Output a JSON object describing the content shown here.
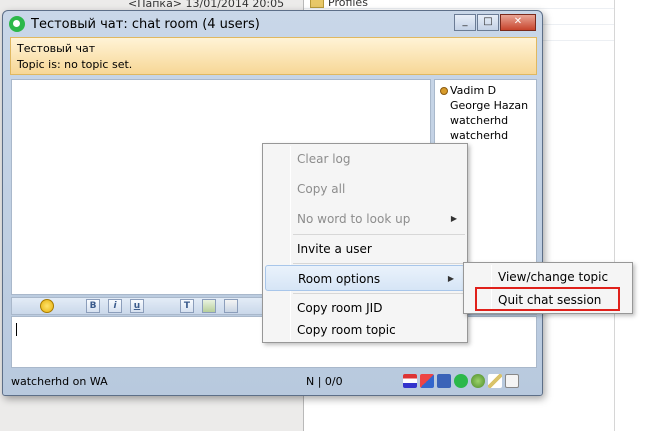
{
  "background": {
    "crumb_text": "<Папка>   13/01/2014 20:05",
    "profiles_label": "Profiles"
  },
  "window": {
    "title": "Тестовый чат: chat room (4 users)",
    "buttons": {
      "minimize": "_",
      "maximize": "□",
      "close": "✕"
    }
  },
  "topic": {
    "room_name": "Тестовый чат",
    "topic_line": "Topic is:  no topic set."
  },
  "users": [
    {
      "name": "Vadim D",
      "status_icon": "status-dot-icon"
    },
    {
      "name": "George Hazan"
    },
    {
      "name": "watcherhd"
    },
    {
      "name": "watcherhd"
    }
  ],
  "format_bar": {
    "bold": "B",
    "italic": "i",
    "underline": "u",
    "text_color": "T"
  },
  "status": {
    "account": "watcherhd on WA",
    "counter": "N | 0/0"
  },
  "context_menu": {
    "items": [
      {
        "label": "Clear log",
        "disabled": true
      },
      {
        "label": "Copy all",
        "disabled": true
      },
      {
        "label": "No word to look up",
        "disabled": true,
        "submenu": true
      },
      {
        "label": "Invite a user"
      },
      {
        "label": "Room options",
        "submenu": true,
        "highlighted": true
      },
      {
        "label": "Copy room JID"
      },
      {
        "label": "Copy room topic"
      }
    ]
  },
  "submenu": {
    "items": [
      {
        "label": "View/change topic"
      },
      {
        "label": "Quit chat session",
        "annotated": true
      }
    ]
  },
  "colors": {
    "topic_bg": "#f7d796",
    "highlight_annotation": "#e0211b",
    "titlebar": "#c9d7e8"
  }
}
